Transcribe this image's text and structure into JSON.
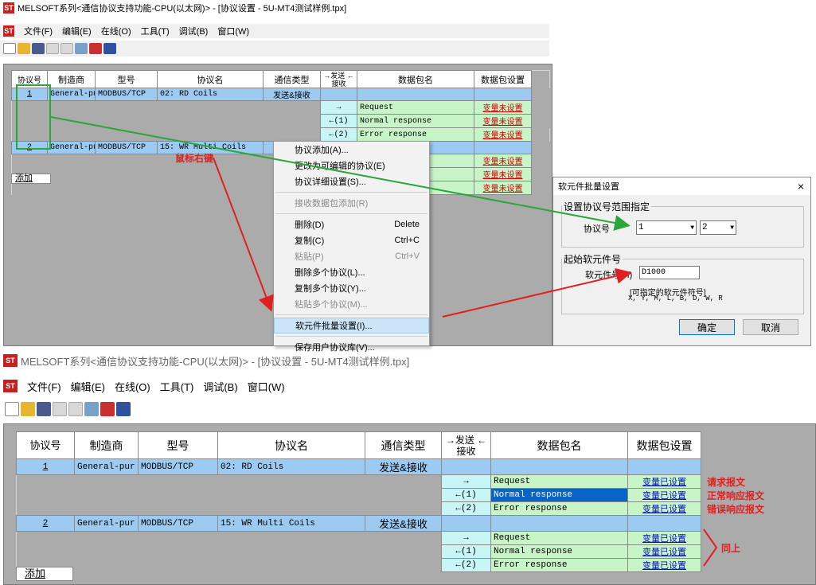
{
  "top": {
    "title": "MELSOFT系列<通信协议支持功能-CPU(以太网)> - [协议设置 - 5U-MT4测试样例.tpx]",
    "menu": [
      "文件(F)",
      "编辑(E)",
      "在线(O)",
      "工具(T)",
      "调试(B)",
      "窗口(W)"
    ],
    "headers": [
      "协议号",
      "制造商",
      "型号",
      "协议名",
      "通信类型",
      "→发送 ←接收",
      "数据包名",
      "数据包设置"
    ],
    "rows": [
      {
        "no": "1",
        "maker": "General-pur",
        "model": "MODBUS/TCP",
        "name": "02: RD Coils",
        "type": "发送&接收"
      },
      {
        "no": "2",
        "maker": "General-pur",
        "model": "MODBUS/TCP",
        "name": "15: WR Multi Coils",
        "type": "发送&接收"
      }
    ],
    "packets": [
      {
        "dir": "→",
        "name": "Request",
        "setting": "变量未设置"
      },
      {
        "dir": "←(1)",
        "name": "Normal response",
        "setting": "变量未设置"
      },
      {
        "dir": "←(2)",
        "name": "Error response",
        "setting": "变量未设置"
      }
    ],
    "packets2_settings": [
      "变量未设置",
      "变量未设置",
      "变量未设置"
    ],
    "packets2_partial": [
      "se",
      "e"
    ],
    "add_button": "添加",
    "annotation_right_click": "鼠标右键"
  },
  "context_menu": {
    "items": [
      {
        "label": "协议添加(A)...",
        "shortcut": "",
        "disabled": false
      },
      {
        "label": "更改为可编辑的协议(E)",
        "shortcut": "",
        "disabled": false
      },
      {
        "label": "协议详细设置(S)...",
        "shortcut": "",
        "disabled": false
      },
      {
        "label": "接收数据包添加(R)",
        "shortcut": "",
        "disabled": true
      },
      {
        "label": "删除(D)",
        "shortcut": "Delete",
        "disabled": false
      },
      {
        "label": "复制(C)",
        "shortcut": "Ctrl+C",
        "disabled": false
      },
      {
        "label": "粘贴(P)",
        "shortcut": "Ctrl+V",
        "disabled": true
      },
      {
        "label": "删除多个协议(L)...",
        "shortcut": "",
        "disabled": false
      },
      {
        "label": "复制多个协议(Y)...",
        "shortcut": "",
        "disabled": false
      },
      {
        "label": "粘贴多个协议(M)...",
        "shortcut": "",
        "disabled": true
      },
      {
        "label": "软元件批量设置(I)...",
        "shortcut": "",
        "disabled": false,
        "selected": true
      },
      {
        "label": "保存用户协议库(V)...",
        "shortcut": "",
        "disabled": false
      }
    ]
  },
  "dialog": {
    "title": "软元件批量设置",
    "close": "×",
    "group1": "设置协议号范围指定",
    "protocol_label": "协议号",
    "from": "1",
    "dash": "-",
    "to": "2",
    "group2": "起始软元件号",
    "device_label": "软元件号(H)",
    "device_value": "D1000",
    "hint1": "[可指定的软元件符号]",
    "hint2": "X, Y, M, L, B, D, W, R",
    "ok": "确定",
    "cancel": "取消"
  },
  "bottom": {
    "title": "MELSOFT系列<通信协议支持功能-CPU(以太网)> - [协议设置 - 5U-MT4测试样例.tpx]",
    "menu": [
      "文件(F)",
      "编辑(E)",
      "在线(O)",
      "工具(T)",
      "调试(B)",
      "窗口(W)"
    ],
    "rows": [
      {
        "no": "1",
        "maker": "General-pur",
        "model": "MODBUS/TCP",
        "name": "02: RD Coils",
        "type": "发送&接收"
      },
      {
        "no": "2",
        "maker": "General-pur",
        "model": "MODBUS/TCP",
        "name": "15: WR Multi Coils",
        "type": "发送&接收"
      }
    ],
    "packets": [
      {
        "dir": "→",
        "name": "Request",
        "setting": "变量已设置"
      },
      {
        "dir": "←(1)",
        "name": "Normal response",
        "setting": "变量已设置"
      },
      {
        "dir": "←(2)",
        "name": "Error response",
        "setting": "变量已设置"
      }
    ],
    "add_button": "添加",
    "annotations": [
      "请求报文",
      "正常响应报文",
      "错误响应报文",
      "同上"
    ]
  },
  "colors": {
    "blue_row": "#9ccaf0",
    "green": "#c8f5c8",
    "cyan": "#c8f5f5",
    "red": "#e02020",
    "arrow_green": "#2aa63a"
  }
}
